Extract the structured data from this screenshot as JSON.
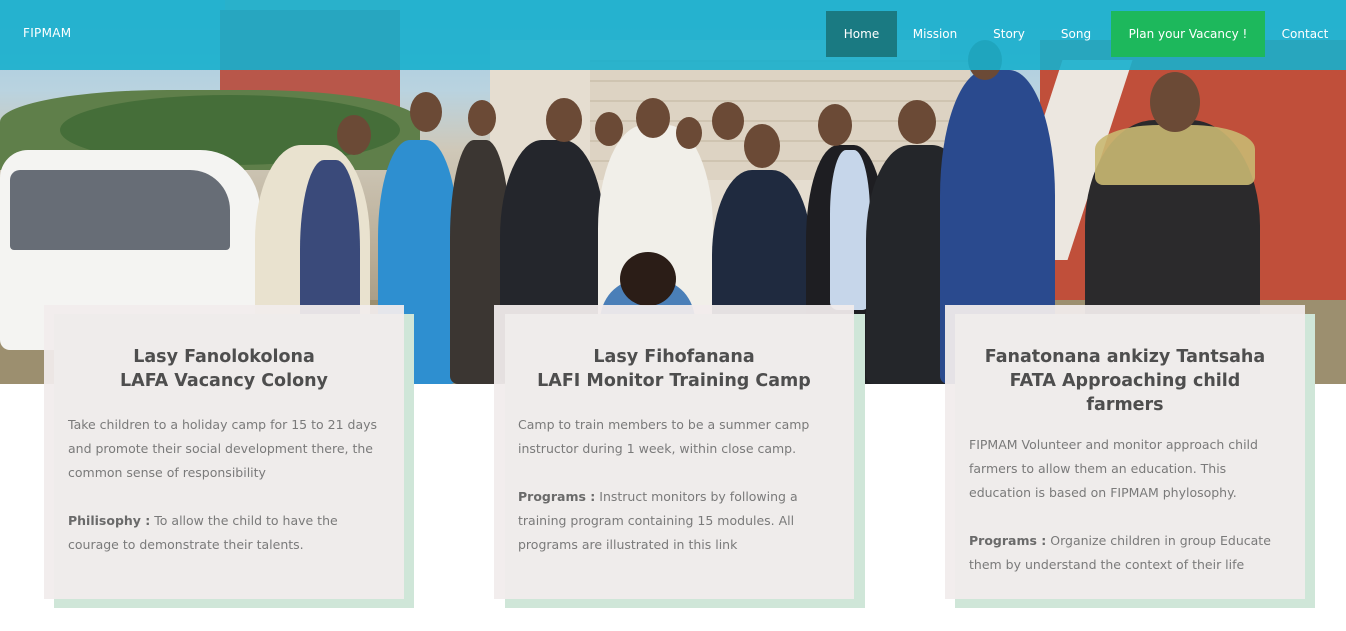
{
  "nav": {
    "brand": "FIPMAM",
    "items": [
      {
        "label": "Home"
      },
      {
        "label": "Mission"
      },
      {
        "label": "Story"
      },
      {
        "label": "Song"
      },
      {
        "label": "Plan your Vacancy !"
      },
      {
        "label": "Contact"
      }
    ],
    "active_color": "#1a7a82",
    "cta_color": "#1db85c",
    "bar_color": "#17afcd"
  },
  "hero": {
    "image": "group-photo"
  },
  "cards": [
    {
      "title_line1": "Lasy Fanolokolona",
      "title_line2": "LAFA Vacancy Colony",
      "title_line3": "",
      "description": "Take children to a holiday camp for 15 to 21 days and promote their social development there, the common sense of responsibility",
      "label": "Philisophy :",
      "detail": "To allow the child to have the courage to demonstrate their talents."
    },
    {
      "title_line1": "Lasy Fihofanana",
      "title_line2": "LAFI Monitor Training Camp",
      "title_line3": "",
      "description": "Camp to train members to be a summer camp instructor during 1 week, within close camp.",
      "label": "Programs :",
      "detail": "Instruct monitors by following a training program containing 15 modules. All programs are illustrated in this link"
    },
    {
      "title_line1": "Fanatonana ankizy Tantsaha",
      "title_line2": "FATA Approaching child",
      "title_line3": "farmers",
      "description": "FIPMAM Volunteer and monitor approach child farmers to allow them an education. This education is based on FIPMAM phylosophy.",
      "label": "Programs :",
      "detail": "Organize children in group Educate them by understand the context of their life"
    }
  ]
}
